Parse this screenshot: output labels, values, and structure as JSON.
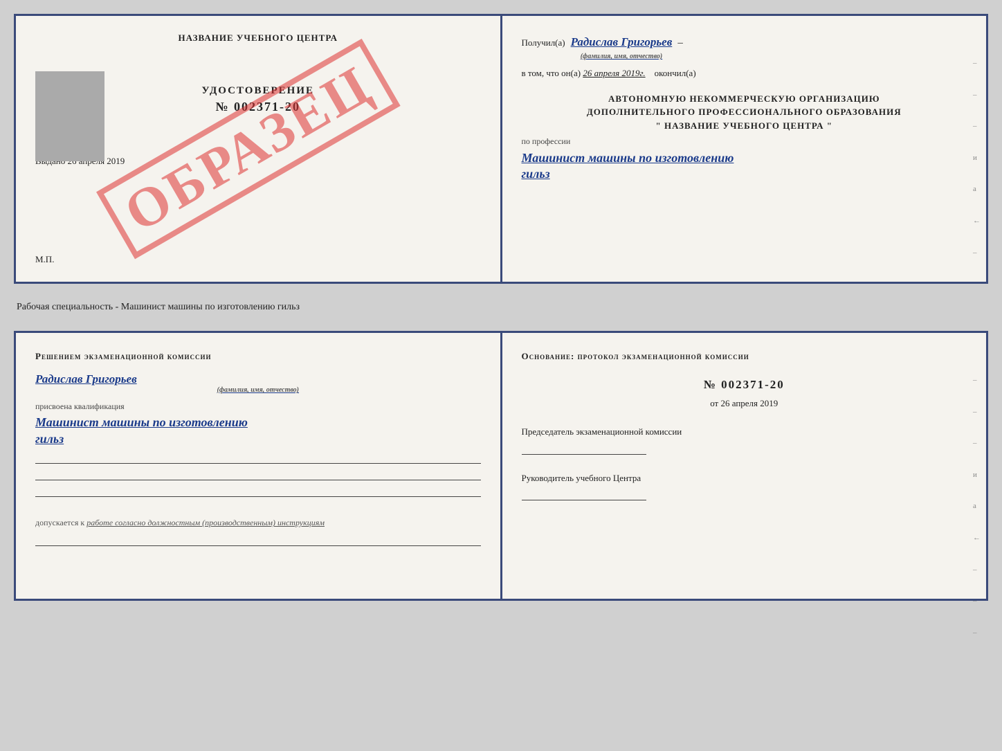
{
  "diploma": {
    "left": {
      "school_title": "НАЗВАНИЕ УЧЕБНОГО ЦЕНТРА",
      "photo_alt": "фото",
      "certificate_label": "УДОСТОВЕРЕНИЕ",
      "cert_number": "№ 002371-20",
      "issued_label": "Выдано",
      "issued_date": "26 апреля 2019",
      "mp_label": "М.П.",
      "watermark": "ОБРАЗЕЦ"
    },
    "right": {
      "received_label": "Получил(а)",
      "recipient_name": "Радислав Григорьев",
      "fio_hint": "(фамилия, имя, отчество)",
      "dash": "–",
      "date_intro": "в том, что он(а)",
      "date_value": "26 апреля 2019г.",
      "finished_label": "окончил(а)",
      "org_line1": "АВТОНОМНУЮ НЕКОММЕРЧЕСКУЮ ОРГАНИЗАЦИЮ",
      "org_line2": "ДОПОЛНИТЕЛЬНОГО ПРОФЕССИОНАЛЬНОГО ОБРАЗОВАНИЯ",
      "org_name": "\" НАЗВАНИЕ УЧЕБНОГО ЦЕНТРА \"",
      "profession_label": "по профессии",
      "profession_value": "Машинист машины по изготовлению",
      "profession_value2": "гильз",
      "edge_hints": [
        "–",
        "–",
        "–",
        "и",
        "а",
        "←",
        "–"
      ]
    }
  },
  "specialty_line": "Рабочая специальность - Машинист машины по изготовлению гильз",
  "qualification": {
    "left": {
      "decision_title": "Решением  экзаменационной  комиссии",
      "person_name": "Радислав Григорьев",
      "fio_hint": "(фамилия, имя, отчество)",
      "assigned_label": "присвоена квалификация",
      "profession_value": "Машинист машины по изготовлению",
      "profession_value2": "гильз",
      "allowed_label": "допускается к",
      "allowed_text": "работе согласно должностным (производственным) инструкциям"
    },
    "right": {
      "basis_title": "Основание: протокол экзаменационной  комиссии",
      "protocol_prefix": "№",
      "protocol_number": "002371-20",
      "date_prefix": "от",
      "date_value": "26 апреля 2019",
      "commission_head_label": "Председатель экзаменационной комиссии",
      "center_head_label": "Руководитель учебного Центра",
      "edge_hints": [
        "–",
        "–",
        "–",
        "и",
        "а",
        "←",
        "–",
        "–",
        "–"
      ]
    }
  }
}
